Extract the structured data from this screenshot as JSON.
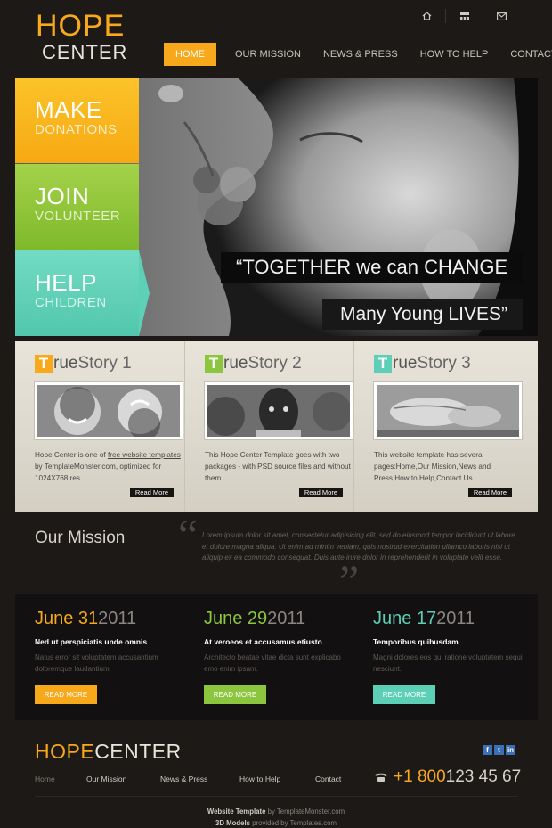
{
  "header": {
    "logo_line1": "HOPE",
    "logo_line2": "CENTER",
    "icons": [
      "home-icon",
      "sitemap-icon",
      "mail-icon"
    ],
    "nav": [
      "HOME",
      "OUR MISSION",
      "NEWS & PRESS",
      "HOW TO HELP",
      "CONTACT"
    ],
    "active_nav": "HOME"
  },
  "hero": {
    "tiles": [
      {
        "title": "MAKE",
        "subtitle": "DONATIONS"
      },
      {
        "title": "JOIN",
        "subtitle": "VOLUNTEER"
      },
      {
        "title": "HELP",
        "subtitle": "CHILDREN"
      }
    ],
    "quote_line1": "“TOGETHER we can CHANGE",
    "quote_line2": "Many Young LIVES”"
  },
  "stories": [
    {
      "letter": "T",
      "rest": "rue",
      "suffix": "Story 1",
      "color": "#f7a81b",
      "text_pre": "Hope Center is one of ",
      "link": "free website templates",
      "text_post": " by TemplateMonster.com, optimized for 1024X768 res.",
      "read_more": "Read More"
    },
    {
      "letter": "T",
      "rest": "rue",
      "suffix": "Story 2",
      "color": "#8cc63f",
      "text_pre": "This Hope Center Template goes with two packages - with PSD source files and without them.",
      "link": "",
      "text_post": "",
      "read_more": "Read More"
    },
    {
      "letter": "T",
      "rest": "rue",
      "suffix": "Story 3",
      "color": "#5ccfb6",
      "text_pre": "This website template has several pages:Home,Our Mission,News and Press,How to Help,Contact Us.",
      "link": "",
      "text_post": "",
      "read_more": "Read More"
    }
  ],
  "mission": {
    "title": "Our Mission",
    "quote": "Lorem ipsum dolor sit amet, consectetur adipisicing elit, sed do eiusmod tempor incididunt ut labore et dolore magna aliqua. Ut enim ad minim veniam, quis nostrud exercitation ullamco laboris nisi ut aliquip ex ea commodo consequat. Duis aute irure dolor in reprehenderit in voluptate velit esse."
  },
  "events": [
    {
      "date": "June 31",
      "year": "2011",
      "color": "#f7a81b",
      "title": "Ned ut perspiciatis unde omnis",
      "text": "Natus error sit voluptatem accusantium doloremque laudantium.",
      "button": "READ MORE"
    },
    {
      "date": "June 29",
      "year": "2011",
      "color": "#8cc63f",
      "title": "At veroeos et accusamus etiusto",
      "text": "Architecto beatae vitae dicta sunt explicabo emo enim ipsam.",
      "button": "READ MORE"
    },
    {
      "date": "June 17",
      "year": "2011",
      "color": "#5ccfb6",
      "title": "Temporibus quibusdam",
      "text": "Magni dolores eos qui ratione voluptatem sequi nesciunt.",
      "button": "READ MORE"
    }
  ],
  "footer": {
    "logo_a": "HOPE",
    "logo_b": "CENTER",
    "social": [
      "f",
      "t",
      "in"
    ],
    "nav": [
      "Home",
      "Our Mission",
      "News & Press",
      "How to Help",
      "Contact"
    ],
    "phone_a": "+1 800",
    "phone_b": "123 45 67",
    "credit1_a": "Website Template",
    "credit1_b": " by TemplateMonster.com",
    "credit2_a": "3D Models",
    "credit2_b": " provided by Templates.com"
  },
  "colors": {
    "orange": "#f7a81b",
    "green": "#8cc63f",
    "teal": "#5ccfb6",
    "bg": "#1c1917"
  }
}
